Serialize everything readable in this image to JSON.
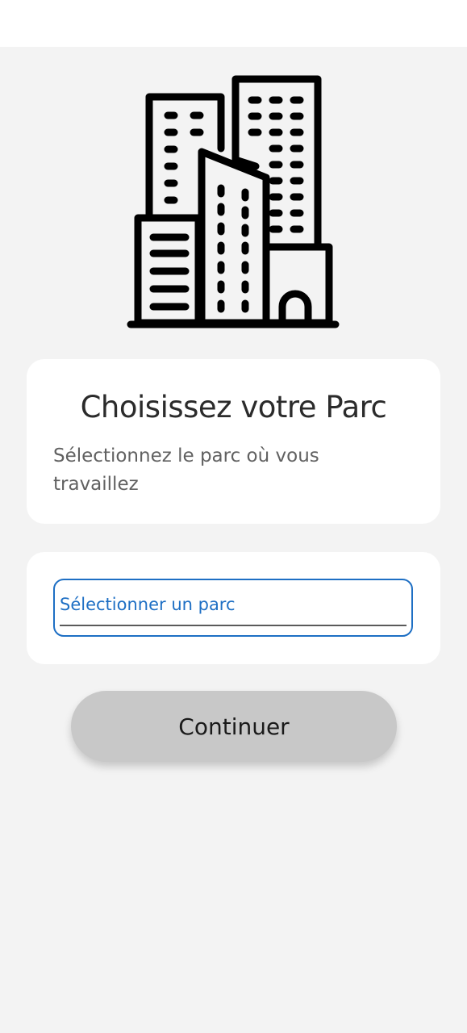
{
  "header": {
    "illustration_icon": "city-buildings-icon"
  },
  "intro_card": {
    "title": "Choisissez votre Parc",
    "subtitle": "Sélectionnez le parc où vous travaillez"
  },
  "park_select": {
    "label": "Sélectionner un parc",
    "accent_color": "#1e6fc4"
  },
  "actions": {
    "continue_label": "Continuer",
    "button_color": "#c8c8c8"
  }
}
